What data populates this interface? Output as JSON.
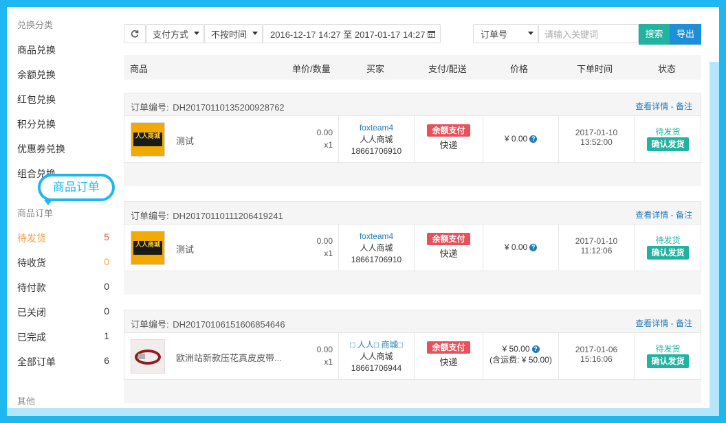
{
  "sidebar": {
    "section1_title": "兑换分类",
    "exchange_items": [
      "商品兑换",
      "余额兑换",
      "红包兑换",
      "积分兑换",
      "优惠券兑换",
      "组合兑换"
    ],
    "bubble": "商品订单",
    "section2_title": "商品订单",
    "order_items": [
      {
        "label": "待发货",
        "count": "5"
      },
      {
        "label": "待收货",
        "count": "0"
      },
      {
        "label": "待付款",
        "count": "0"
      },
      {
        "label": "已关闭",
        "count": "0"
      },
      {
        "label": "已完成",
        "count": "1"
      },
      {
        "label": "全部订单",
        "count": "6"
      }
    ],
    "section3_title": "其他"
  },
  "toolbar": {
    "refresh_icon": "refresh-icon",
    "payment_select": "支付方式",
    "time_select": "不按时间",
    "date_range": "2016-12-17 14:27 至 2017-01-17 14:27",
    "calendar_icon": "calendar-icon",
    "field_select": "订单号",
    "search_placeholder": "请输入关键词",
    "search_label": "搜索",
    "export_label": "导出"
  },
  "table_header": {
    "product": "商品",
    "unit_qty": "单价/数量",
    "buyer": "买家",
    "pay_ship": "支付/配送",
    "price": "价格",
    "order_time": "下单时间",
    "status": "状态"
  },
  "orders": [
    {
      "label": "订单编号:",
      "order_no": "DH20170110135200928762",
      "detail_link": "查看详情",
      "sep": "-",
      "note_link": "备注",
      "product_name": "测试",
      "unit_price": "0.00",
      "qty": "x1",
      "buyer_nick": "foxteam4",
      "buyer_shop": "人人商城",
      "buyer_phone": "18661706910",
      "pay_badge": "余额支付",
      "ship": "快递",
      "price": "¥ 0.00",
      "price_note": "",
      "date": "2017-01-10",
      "time": "13:52:00",
      "status": "待发货",
      "action": "确认发货",
      "thumb_text": "人人商城"
    },
    {
      "label": "订单编号:",
      "order_no": "DH20170110111206419241",
      "detail_link": "查看详情",
      "sep": "-",
      "note_link": "备注",
      "product_name": "测试",
      "unit_price": "0.00",
      "qty": "x1",
      "buyer_nick": "foxteam4",
      "buyer_shop": "人人商城",
      "buyer_phone": "18661706910",
      "pay_badge": "余额支付",
      "ship": "快递",
      "price": "¥ 0.00",
      "price_note": "",
      "date": "2017-01-10",
      "time": "11:12:06",
      "status": "待发货",
      "action": "确认发货",
      "thumb_text": "人人商城"
    },
    {
      "label": "订单编号:",
      "order_no": "DH20170106151606854646",
      "detail_link": "查看详情",
      "sep": "-",
      "note_link": "备注",
      "product_name": "欧洲站新款压花真皮皮带...",
      "unit_price": "0.00",
      "qty": "x1",
      "buyer_nick": "□ 人人□ 商城□",
      "buyer_shop": "人人商城",
      "buyer_phone": "18661706944",
      "pay_badge": "余额支付",
      "ship": "快递",
      "price": "¥ 50.00",
      "price_note": "(含运费: ¥ 50.00)",
      "date": "2017-01-06",
      "time": "15:16:06",
      "status": "待发货",
      "action": "确认发货",
      "thumb_text": ""
    }
  ],
  "colors": {
    "brand_blue": "#1eb7f0",
    "search_green": "#21b39f",
    "export_blue": "#1f8ed8",
    "pay_red": "#e8505b",
    "pending_orange": "#f39c42"
  }
}
